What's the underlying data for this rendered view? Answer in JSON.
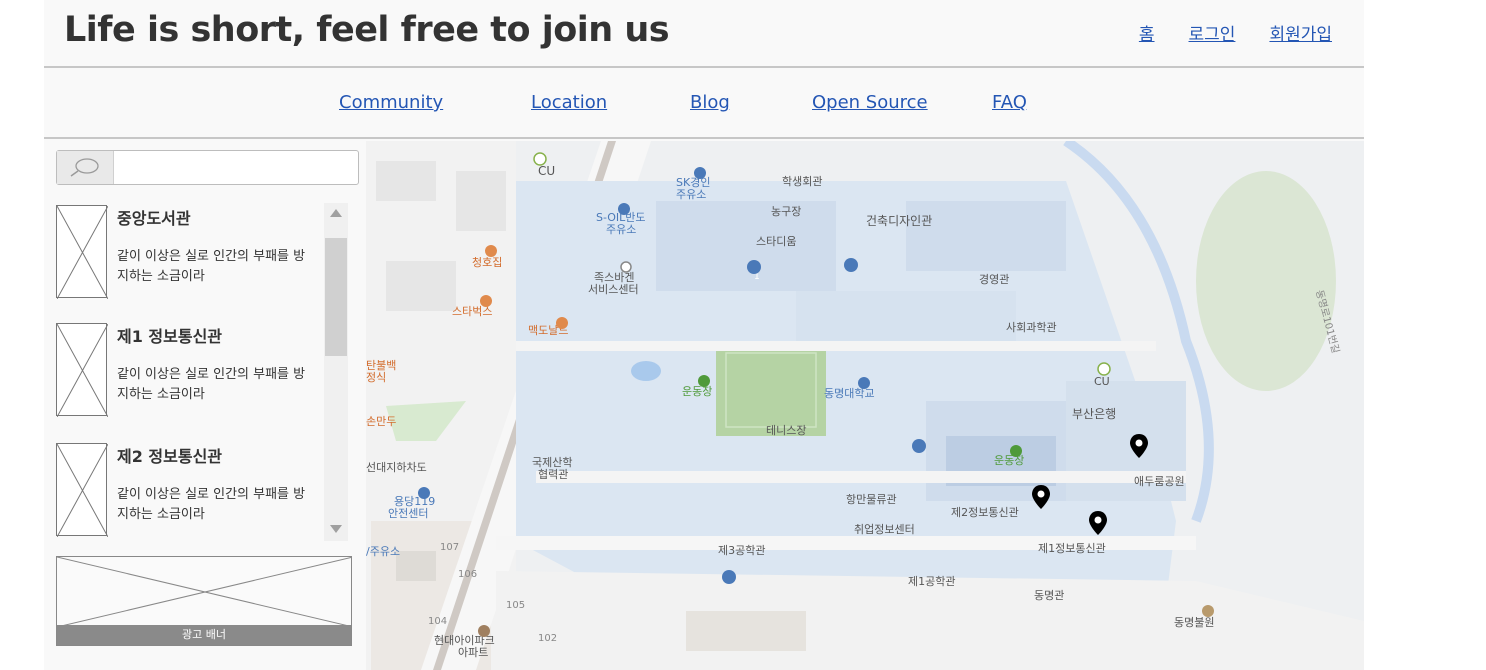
{
  "header": {
    "title": "Life is short, feel free to join us",
    "links": [
      {
        "label": "홈"
      },
      {
        "label": "로그인"
      },
      {
        "label": "회원가입"
      }
    ]
  },
  "nav": {
    "items": [
      {
        "label": "Community"
      },
      {
        "label": "Location"
      },
      {
        "label": "Blog"
      },
      {
        "label": "Open Source"
      },
      {
        "label": "FAQ"
      }
    ]
  },
  "sidebar": {
    "search": {
      "value": "",
      "placeholder": ""
    },
    "items": [
      {
        "title": "중앙도서관",
        "desc": "같이 이상은 실로 인간의 부패를 방지하는 소금이라"
      },
      {
        "title": "제1 정보통신관",
        "desc": "같이 이상은 실로 인간의 부패를 방지하는 소금이라"
      },
      {
        "title": "제2 정보통신관",
        "desc": "같이 이상은 실로 인간의 부패를 방지하는 소금이라"
      }
    ],
    "ad_label": "광고 배너"
  },
  "map": {
    "labels": {
      "cu_top": "CU",
      "sk": "SK경인",
      "sk2": "주유소",
      "student_hall": "학생회관",
      "nonggu": "농구장",
      "soil": "S-OIL반도",
      "soil2": "주유소",
      "stadium": "스타디움",
      "arch": "건축디자인관",
      "chunghojip": "청호집",
      "foot": "족스바겐",
      "foot2": "서비스센터",
      "management": "경영관",
      "starbucks": "스타벅스",
      "mcd": "맥도날드",
      "social": "사회과학관",
      "tanbul": "탄불백",
      "tanbul2": "정식",
      "playground1": "운동장",
      "dongmyung_univ": "동명대학교",
      "cu_right": "CU",
      "busan_bank": "부산은행",
      "tennis": "테니스장",
      "sondudu": "손만두",
      "intl": "국제산학",
      "intl2": "협력관",
      "playground2": "운동장",
      "daeji": "선대지하차도",
      "yongdang": "용당119",
      "yongdang2": "안전센터",
      "hangman": "항만물류관",
      "info2": "제2정보통신관",
      "park_edu": "애두룸공원",
      "career": "취업정보센터",
      "info1": "제1정보통신관",
      "eng3": "제3공학관",
      "gas": "/주유소",
      "eng1": "제1공학관",
      "dongmyung_hall": "동명관",
      "n107": "107",
      "n106": "106",
      "n105": "105",
      "n104": "104",
      "n102": "102",
      "hyundai": "현대아이파크",
      "hyundai2": "아파트",
      "dongmyung_park": "동명불원",
      "road": "동명로101번길",
      "p1": "1"
    }
  }
}
